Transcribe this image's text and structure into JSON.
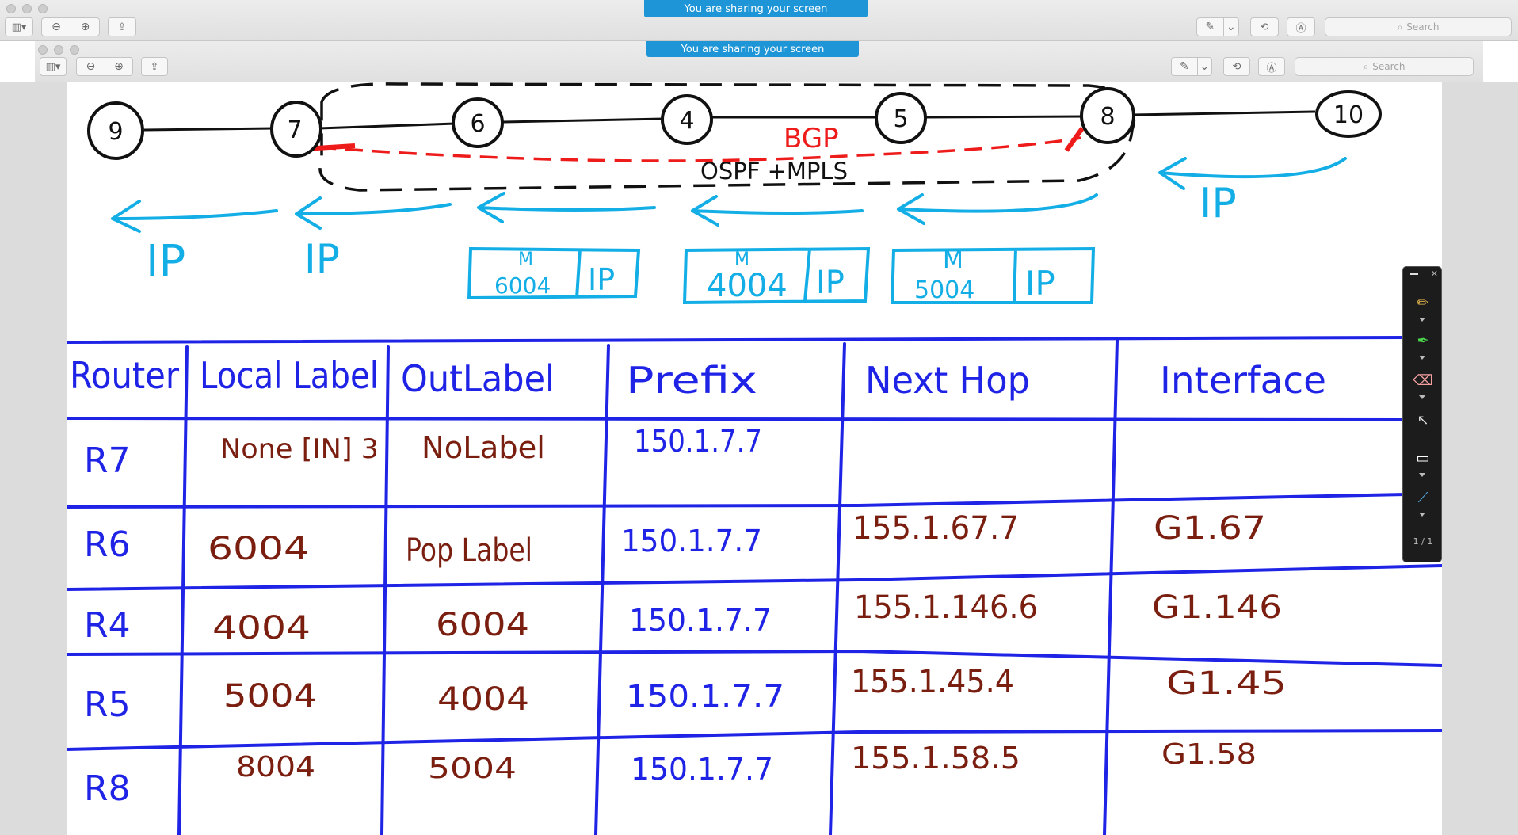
{
  "banner": {
    "sharing_text": "You are sharing your screen"
  },
  "toolbar": {
    "search_placeholder": "Search"
  },
  "diagram": {
    "routers": [
      "9",
      "7",
      "6",
      "4",
      "5",
      "8",
      "10"
    ],
    "bgp_label": "BGP",
    "igp_label": "OSPF +MPLS",
    "ip_label": "IP",
    "packets": [
      {
        "m": "M",
        "label": "6004",
        "payload": "IP"
      },
      {
        "m": "M",
        "label": "4004",
        "payload": "IP"
      },
      {
        "m": "M",
        "label": "5004",
        "payload": "IP"
      }
    ]
  },
  "table": {
    "headers": [
      "Router",
      "Local Label",
      "OutLabel",
      "Prefix",
      "Next Hop",
      "Interface"
    ],
    "rows": [
      [
        "R7",
        "None [IN] 3",
        "NoLabel",
        "150.1.7.7",
        "",
        ""
      ],
      [
        "R6",
        "6004",
        "Pop Label",
        "150.1.7.7",
        "155.1.67.7",
        "G1.67"
      ],
      [
        "R4",
        "4004",
        "6004",
        "150.1.7.7",
        "155.1.146.6",
        "G1.146"
      ],
      [
        "R5",
        "5004",
        "4004",
        "150.1.7.7",
        "155.1.45.4",
        "G1.45"
      ],
      [
        "R8",
        "8004",
        "5004",
        "150.1.7.7",
        "155.1.58.5",
        "G1.58"
      ]
    ]
  },
  "annotation_toolbar": {
    "page_indicator": "1 / 1"
  },
  "colors": {
    "blue_ink": "#1f23e6",
    "cyan_ink": "#14aee6",
    "brown_ink": "#7a1e10",
    "red_ink": "#ee1b1b",
    "black_ink": "#111111",
    "banner": "#1d95d6"
  }
}
